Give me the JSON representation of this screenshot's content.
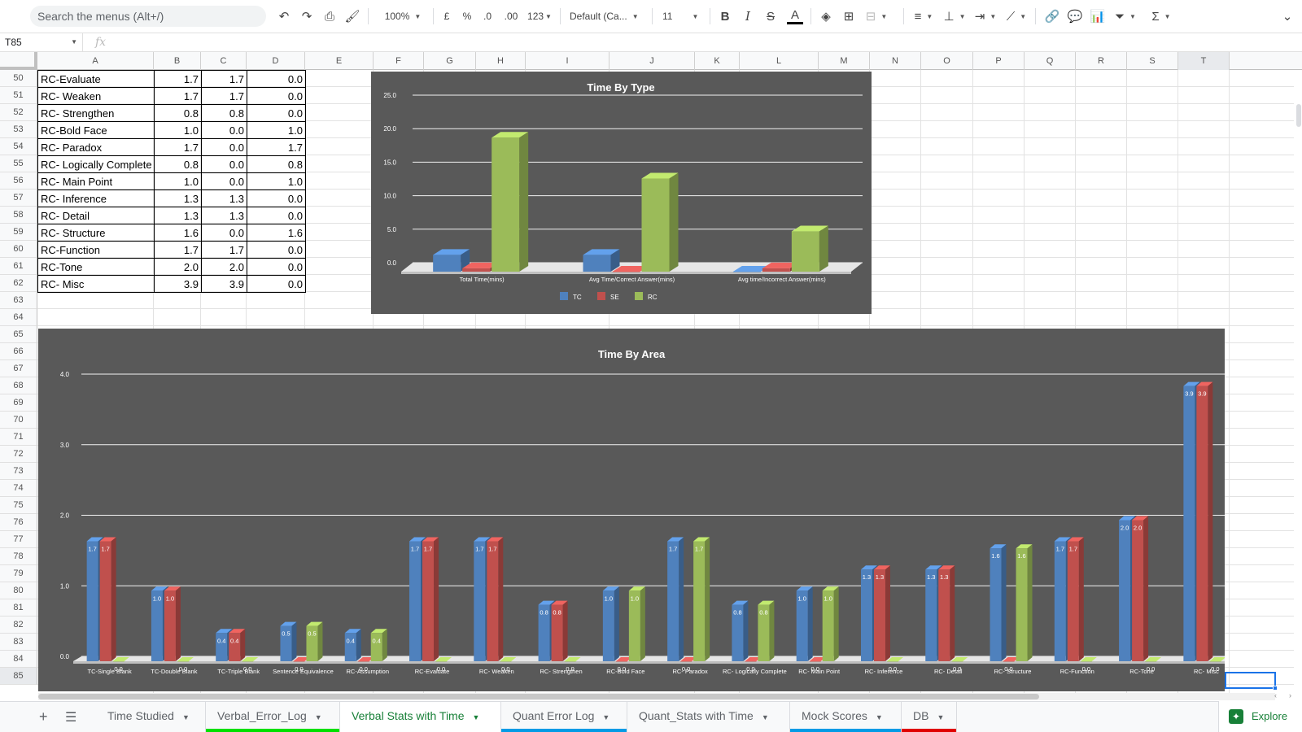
{
  "toolbar": {
    "search_placeholder": "Search the menus (Alt+/)",
    "zoom": "100%",
    "currency": "£",
    "percent": "%",
    "decimal_decrease": ".0",
    "decimal_increase": ".00",
    "number_format": "123",
    "font": "Default (Ca...",
    "font_size": "11",
    "bold": "B",
    "italic": "I",
    "strike": "S",
    "textcolor": "A"
  },
  "formula_bar": {
    "cell_ref": "T85",
    "fx": "fx",
    "value": ""
  },
  "columns": [
    "A",
    "B",
    "C",
    "D",
    "E",
    "F",
    "G",
    "H",
    "I",
    "J",
    "K",
    "L",
    "M",
    "N",
    "O",
    "P",
    "Q",
    "R",
    "S",
    "T"
  ],
  "rows": [
    "50",
    "51",
    "52",
    "53",
    "54",
    "55",
    "56",
    "57",
    "58",
    "59",
    "60",
    "61",
    "62",
    "63",
    "64",
    "65",
    "66",
    "67",
    "68",
    "69",
    "70",
    "71",
    "72",
    "73",
    "74",
    "75",
    "76",
    "77",
    "78",
    "79",
    "80",
    "81",
    "82",
    "83",
    "84",
    "85"
  ],
  "table": [
    {
      "label": "RC-Evaluate",
      "b": "1.7",
      "c": "1.7",
      "d": "0.0"
    },
    {
      "label": "RC- Weaken",
      "b": "1.7",
      "c": "1.7",
      "d": "0.0"
    },
    {
      "label": "RC- Strengthen",
      "b": "0.8",
      "c": "0.8",
      "d": "0.0"
    },
    {
      "label": "RC-Bold Face",
      "b": "1.0",
      "c": "0.0",
      "d": "1.0"
    },
    {
      "label": "RC- Paradox",
      "b": "1.7",
      "c": "0.0",
      "d": "1.7"
    },
    {
      "label": "RC- Logically Complete",
      "b": "0.8",
      "c": "0.0",
      "d": "0.8"
    },
    {
      "label": "RC- Main Point",
      "b": "1.0",
      "c": "0.0",
      "d": "1.0"
    },
    {
      "label": "RC- Inference",
      "b": "1.3",
      "c": "1.3",
      "d": "0.0"
    },
    {
      "label": "RC- Detail",
      "b": "1.3",
      "c": "1.3",
      "d": "0.0"
    },
    {
      "label": "RC- Structure",
      "b": "1.6",
      "c": "0.0",
      "d": "1.6"
    },
    {
      "label": "RC-Function",
      "b": "1.7",
      "c": "1.7",
      "d": "0.0"
    },
    {
      "label": "RC-Tone",
      "b": "2.0",
      "c": "2.0",
      "d": "0.0"
    },
    {
      "label": "RC- Misc",
      "b": "3.9",
      "c": "3.9",
      "d": "0.0"
    }
  ],
  "chart_data": [
    {
      "type": "bar",
      "title": "Time By Type",
      "categories": [
        "Total Time(mins)",
        "Avg Time/Correct Answer(mins)",
        "Avg time/Incorrect Answer(mins)"
      ],
      "series": [
        {
          "name": "TC",
          "color": "#4f81bd",
          "values": [
            2.5,
            2.5,
            0.0
          ]
        },
        {
          "name": "SE",
          "color": "#c0504d",
          "values": [
            0.5,
            0.0,
            0.5
          ]
        },
        {
          "name": "RC",
          "color": "#9bbb59",
          "values": [
            20.0,
            13.9,
            6.0
          ]
        }
      ],
      "ylim": [
        0,
        25
      ],
      "yticks": [
        "0.0",
        "5.0",
        "10.0",
        "15.0",
        "20.0",
        "25.0"
      ],
      "legend": "bottom",
      "grid": true
    },
    {
      "type": "bar",
      "title": "Time By Area",
      "categories": [
        "TC-Single Blank",
        "TC-Double Blank",
        "TC-Triple Blank",
        "Sentence Equivalence",
        "RC-Assumption",
        "RC-Evaluate",
        "RC- Weaken",
        "RC- Strengthen",
        "RC-Bold Face",
        "RC- Paradox",
        "RC- Logically Complete",
        "RC- Main Point",
        "RC- Inference",
        "RC- Detail",
        "RC- Structure",
        "RC-Function",
        "RC-Tone",
        "RC- Misc"
      ],
      "series": [
        {
          "color": "#4f81bd",
          "values": [
            1.7,
            1.0,
            0.4,
            0.5,
            0.4,
            1.7,
            1.7,
            0.8,
            1.0,
            1.7,
            0.8,
            1.0,
            1.3,
            1.3,
            1.6,
            1.7,
            2.0,
            3.9
          ]
        },
        {
          "color": "#c0504d",
          "values": [
            1.7,
            1.0,
            0.4,
            0.0,
            0.0,
            1.7,
            1.7,
            0.8,
            0.0,
            0.0,
            0.0,
            0.0,
            1.3,
            1.3,
            0.0,
            1.7,
            2.0,
            3.9
          ]
        },
        {
          "color": "#9bbb59",
          "values": [
            0.0,
            0.0,
            0.0,
            0.5,
            0.4,
            0.0,
            0.0,
            0.0,
            1.0,
            1.7,
            0.8,
            1.0,
            0.0,
            0.0,
            1.6,
            0.0,
            0.0,
            0.0
          ]
        }
      ],
      "ylim": [
        0,
        4
      ],
      "yticks": [
        "0.0",
        "1.0",
        "2.0",
        "3.0",
        "4.0"
      ],
      "data_labels": true,
      "grid": true
    }
  ],
  "tabs": [
    {
      "label": "Time Studied",
      "color": ""
    },
    {
      "label": "Verbal_Error_Log",
      "color": "#00e000"
    },
    {
      "label": "Verbal Stats with Time",
      "color": "",
      "active": true
    },
    {
      "label": "Quant Error Log",
      "color": "#039be5"
    },
    {
      "label": "Quant_Stats with Time",
      "color": ""
    },
    {
      "label": "Mock Scores",
      "color": "#039be5"
    },
    {
      "label": "DB",
      "color": "#e00000"
    }
  ],
  "explore_label": "Explore"
}
